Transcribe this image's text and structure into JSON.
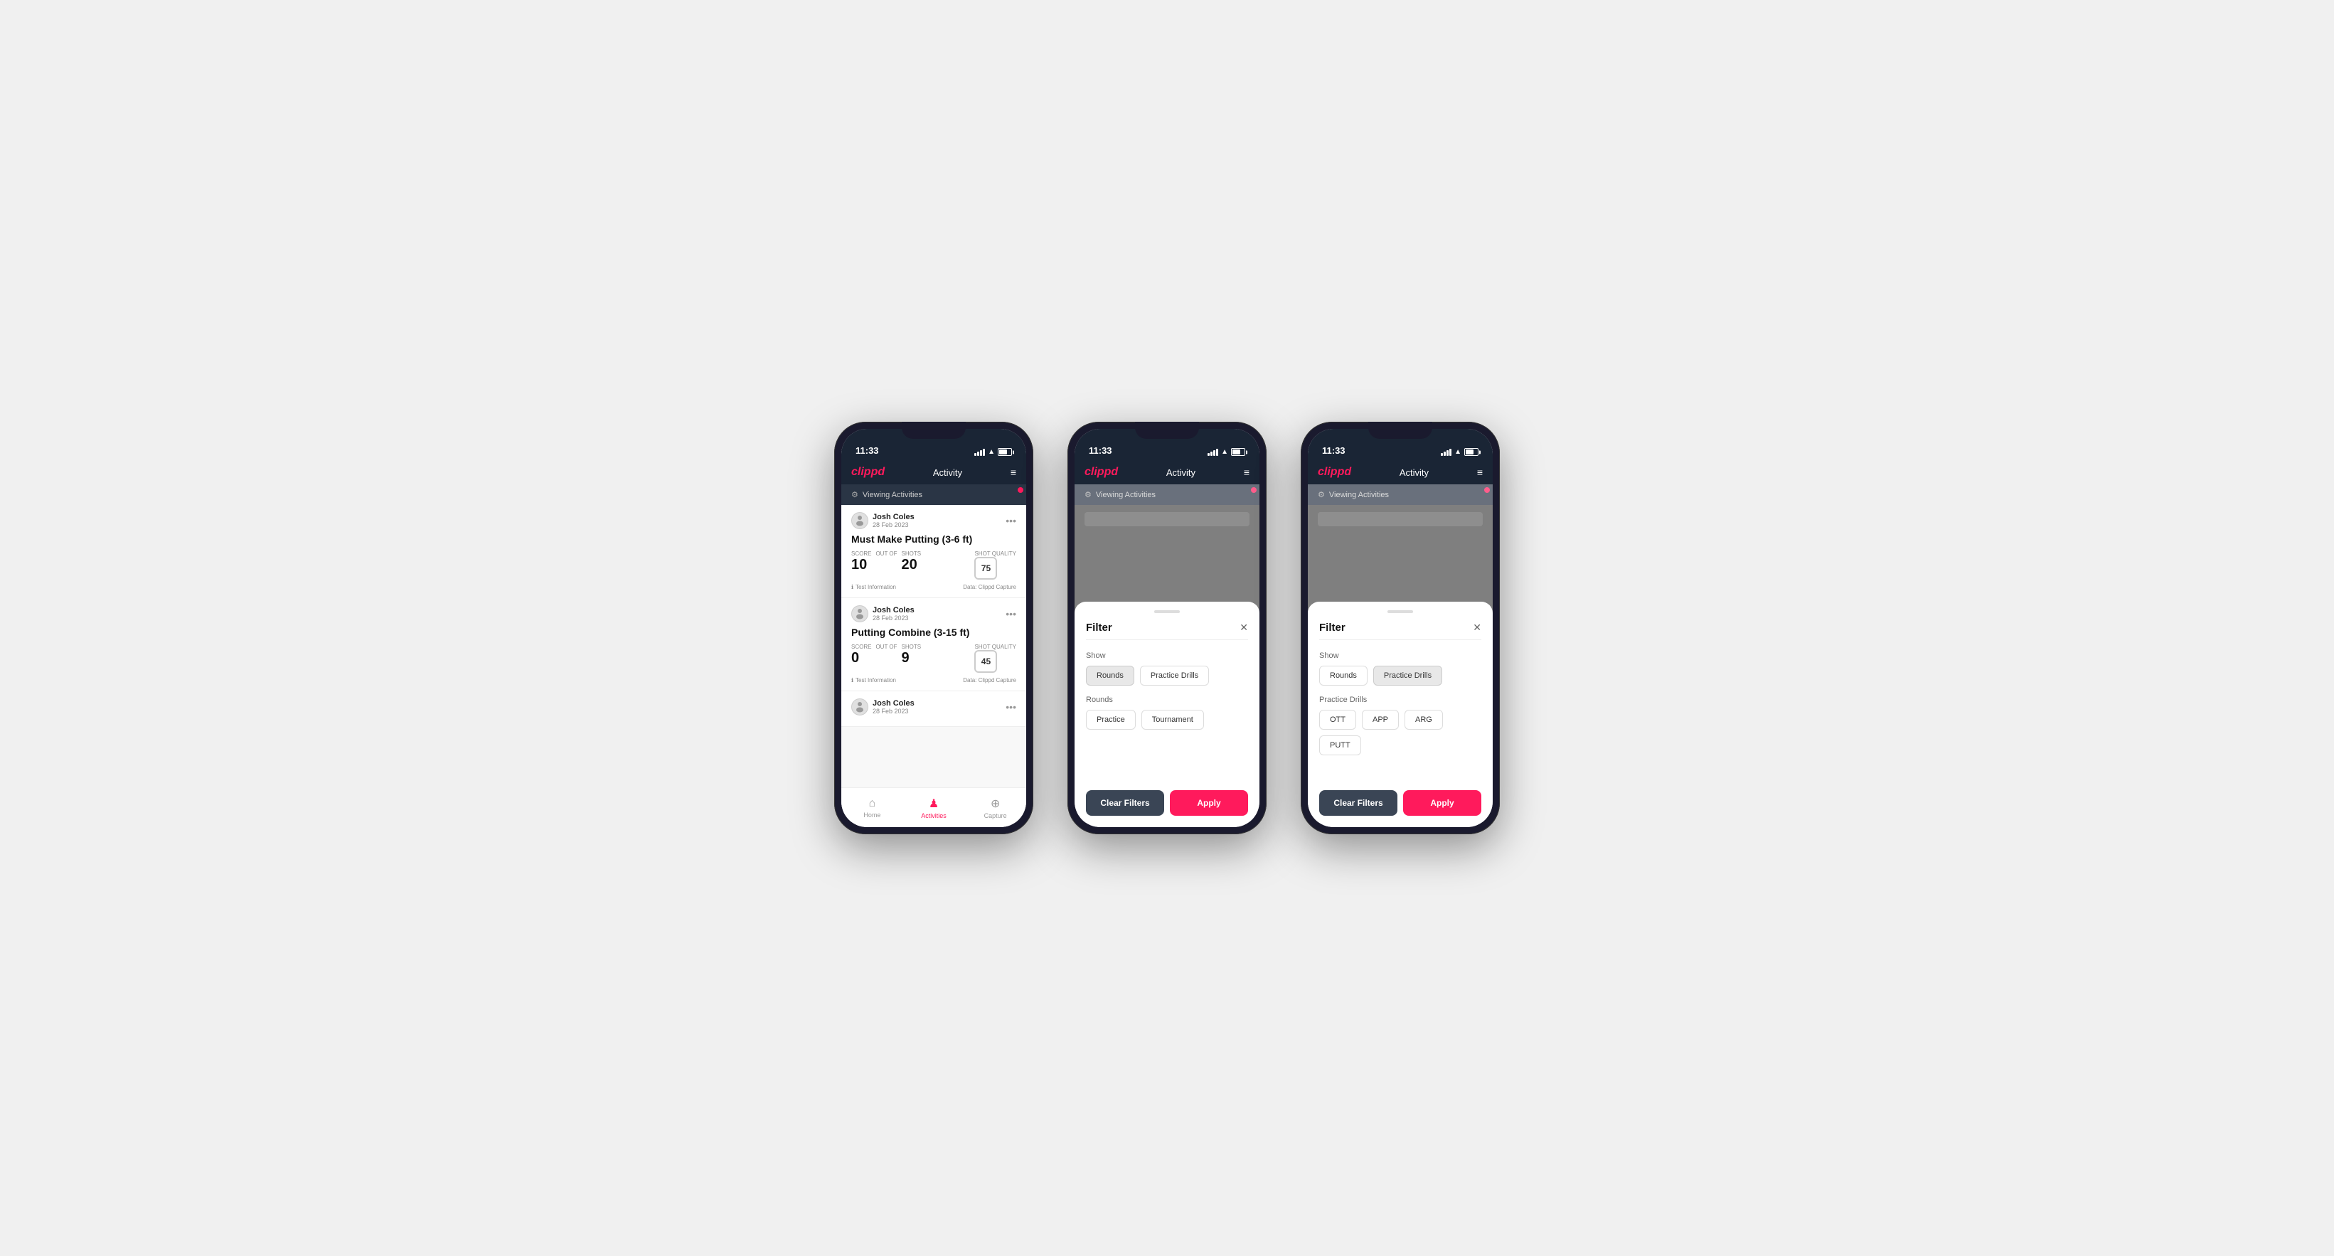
{
  "app": {
    "name": "clippd",
    "header_title": "Activity",
    "status": {
      "time": "11:33",
      "battery_level": 70
    }
  },
  "phones": [
    {
      "id": "phone1",
      "screen": "activities",
      "viewing_activities_label": "Viewing Activities",
      "activities": [
        {
          "user_name": "Josh Coles",
          "user_date": "28 Feb 2023",
          "title": "Must Make Putting (3-6 ft)",
          "score_label": "Score",
          "score_value": "10",
          "out_of_label": "OUT OF",
          "shots_label": "Shots",
          "shots_value": "20",
          "shot_quality_label": "Shot Quality",
          "shot_quality_value": "75",
          "test_info": "Test Information",
          "data_source": "Data: Clippd Capture"
        },
        {
          "user_name": "Josh Coles",
          "user_date": "28 Feb 2023",
          "title": "Putting Combine (3-15 ft)",
          "score_label": "Score",
          "score_value": "0",
          "out_of_label": "OUT OF",
          "shots_label": "Shots",
          "shots_value": "9",
          "shot_quality_label": "Shot Quality",
          "shot_quality_value": "45",
          "test_info": "Test Information",
          "data_source": "Data: Clippd Capture"
        },
        {
          "user_name": "Josh Coles",
          "user_date": "28 Feb 2023",
          "title": "",
          "partial": true
        }
      ],
      "nav": {
        "home_label": "Home",
        "activities_label": "Activities",
        "capture_label": "Capture"
      }
    },
    {
      "id": "phone2",
      "screen": "filter_rounds",
      "viewing_activities_label": "Viewing Activities",
      "filter": {
        "title": "Filter",
        "show_label": "Show",
        "show_buttons": [
          {
            "label": "Rounds",
            "active": true
          },
          {
            "label": "Practice Drills",
            "active": false
          }
        ],
        "rounds_label": "Rounds",
        "round_buttons": [
          {
            "label": "Practice",
            "active": false
          },
          {
            "label": "Tournament",
            "active": false
          }
        ],
        "clear_label": "Clear Filters",
        "apply_label": "Apply"
      }
    },
    {
      "id": "phone3",
      "screen": "filter_drills",
      "viewing_activities_label": "Viewing Activities",
      "filter": {
        "title": "Filter",
        "show_label": "Show",
        "show_buttons": [
          {
            "label": "Rounds",
            "active": false
          },
          {
            "label": "Practice Drills",
            "active": true
          }
        ],
        "drills_label": "Practice Drills",
        "drill_buttons": [
          {
            "label": "OTT",
            "active": false
          },
          {
            "label": "APP",
            "active": false
          },
          {
            "label": "ARG",
            "active": false
          },
          {
            "label": "PUTT",
            "active": false
          }
        ],
        "clear_label": "Clear Filters",
        "apply_label": "Apply"
      }
    }
  ]
}
